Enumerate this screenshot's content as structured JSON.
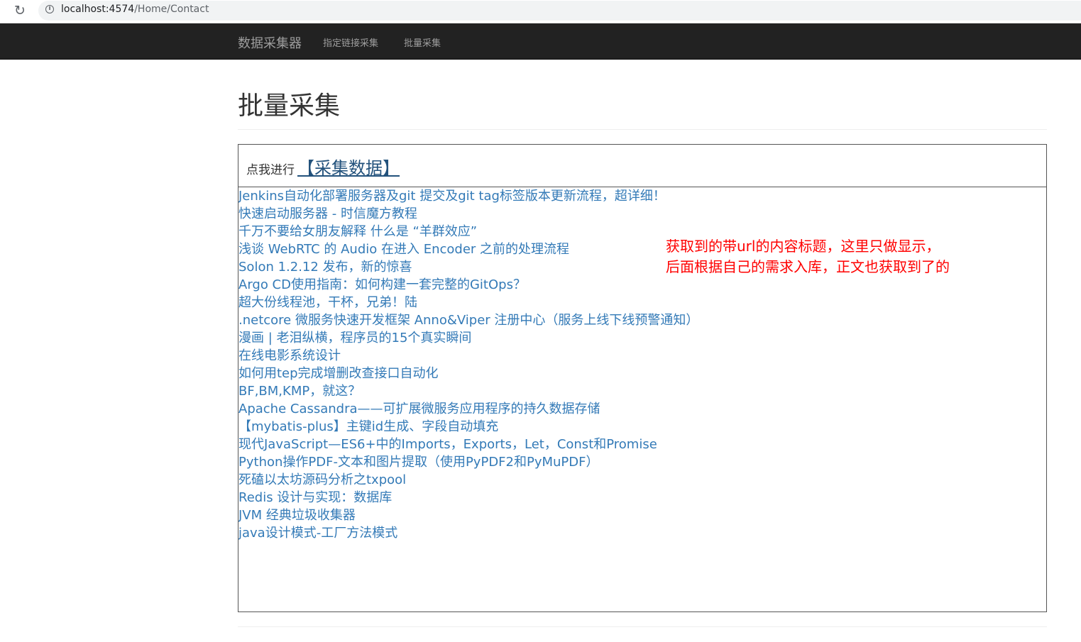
{
  "browser": {
    "url_host": "localhost:4574",
    "url_path": "/Home/Contact"
  },
  "navbar": {
    "brand": "数据采集器",
    "links": [
      "指定链接采集",
      "批量采集"
    ]
  },
  "page": {
    "title": "批量采集",
    "action_prefix": "点我进行",
    "action_link": "【采集数据】"
  },
  "results": [
    "Jenkins自动化部署服务器及git 提交及git tag标签版本更新流程，超详细！",
    "快速启动服务器 - 时信魔方教程",
    "千万不要给女朋友解释 什么是 “羊群效应”",
    "浅谈 WebRTC 的 Audio 在进入 Encoder 之前的处理流程",
    "Solon 1.2.12 发布，新的惊喜",
    "Argo CD使用指南：如何构建一套完整的GitOps？",
    "超大份线程池，干杯，兄弟！陆",
    ".netcore 微服务快速开发框架 Anno&Viper 注册中心（服务上线下线预警通知）",
    "漫画 | 老泪纵横，程序员的15个真实瞬间",
    "在线电影系统设计",
    "如何用tep完成增删改查接口自动化",
    "BF,BM,KMP，就这？",
    "Apache Cassandra——可扩展微服务应用程序的持久数据存储",
    "【mybatis-plus】主键id生成、字段自动填充",
    "现代JavaScript—ES6+中的Imports，Exports，Let，Const和Promise",
    "Python操作PDF-文本和图片提取（使用PyPDF2和PyMuPDF）",
    "死磕以太坊源码分析之txpool",
    "Redis 设计与实现：数据库",
    "JVM 经典垃圾收集器",
    "java设计模式-工厂方法模式"
  ],
  "annotation": {
    "line1": "获取到的带url的内容标题，这里只做显示，",
    "line2": "后面根据自己的需求入库，正文也获取到了的"
  }
}
